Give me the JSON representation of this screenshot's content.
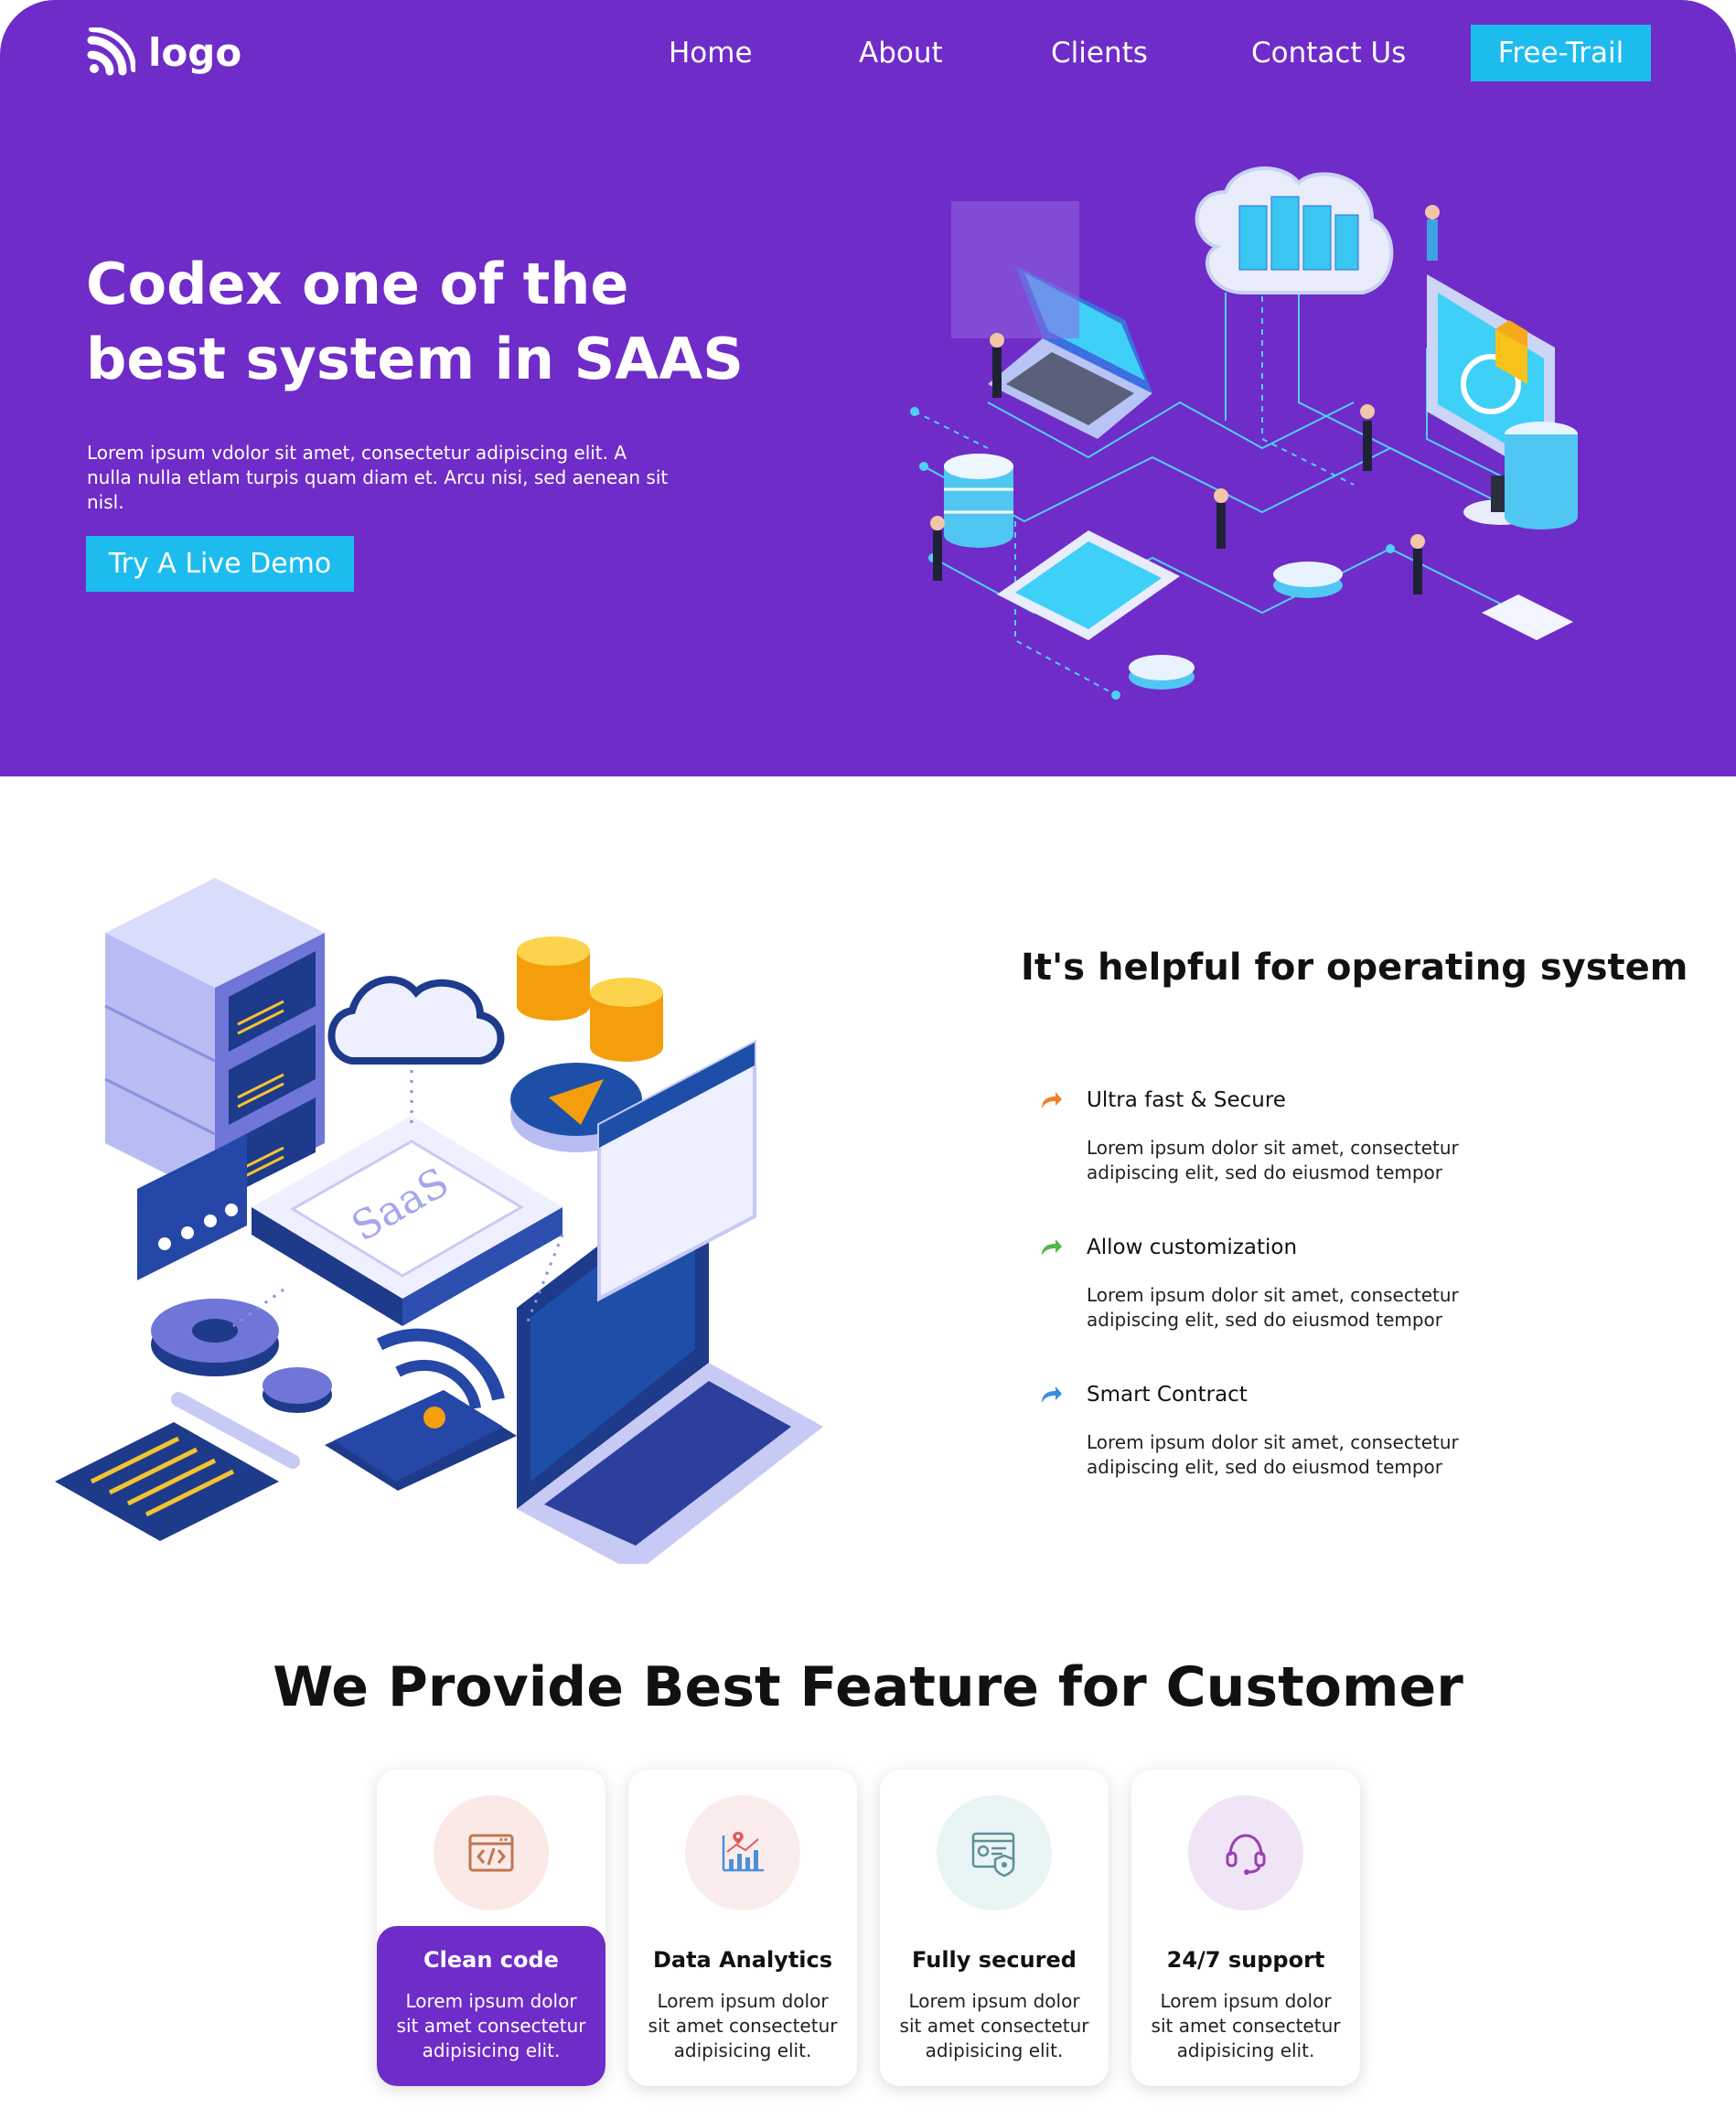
{
  "header": {
    "logo_text": "logo",
    "nav": [
      "Home",
      "About",
      "Clients",
      "Contact Us"
    ],
    "cta_label": "Free-Trail"
  },
  "hero": {
    "title": "Codex one of the best system in SAAS",
    "subtitle": "Lorem ipsum vdolor sit amet, consectetur adipiscing elit. A nulla nulla etlam turpis quam diam et. Arcu nisi, sed aenean sit nisl.",
    "cta_label": "Try A Live Demo"
  },
  "helpful": {
    "title": "It's helpful for operating system",
    "illustration_text": "SaaS",
    "items": [
      {
        "title": "Ultra fast & Secure",
        "desc": "Lorem ipsum dolor sit amet, consectetur adipiscing elit, sed do eiusmod tempor",
        "icon": "arrow-icon",
        "color": "#f07f2a"
      },
      {
        "title": "Allow customization",
        "desc": "Lorem ipsum dolor sit amet, consectetur adipiscing elit, sed do eiusmod tempor",
        "icon": "arrow-icon",
        "color": "#4fb848"
      },
      {
        "title": "Smart Contract",
        "desc": "Lorem ipsum dolor sit amet, consectetur adipiscing elit, sed do eiusmod tempor",
        "icon": "arrow-icon",
        "color": "#3a8fe0"
      }
    ]
  },
  "features": {
    "title": "We Provide Best Feature for Customer",
    "cards": [
      {
        "title": "Clean code",
        "desc": "Lorem ipsum dolor sit amet consectetur adipisicing elit.",
        "icon": "code-icon",
        "circle_color": "#fbe9e8",
        "active": true
      },
      {
        "title": "Data Analytics",
        "desc": "Lorem ipsum dolor sit amet consectetur adipisicing elit.",
        "icon": "analytics-icon",
        "circle_color": "#fbecec",
        "active": false
      },
      {
        "title": "Fully secured",
        "desc": "Lorem ipsum dolor sit amet consectetur adipisicing elit.",
        "icon": "security-icon",
        "circle_color": "#e9f4f4",
        "active": false
      },
      {
        "title": "24/7 support",
        "desc": "Lorem ipsum dolor sit amet consectetur adipisicing elit.",
        "icon": "headset-icon",
        "circle_color": "#efe5f6",
        "active": false
      }
    ]
  },
  "colors": {
    "brand": "#6f2cc8",
    "accent": "#1dbcee"
  }
}
